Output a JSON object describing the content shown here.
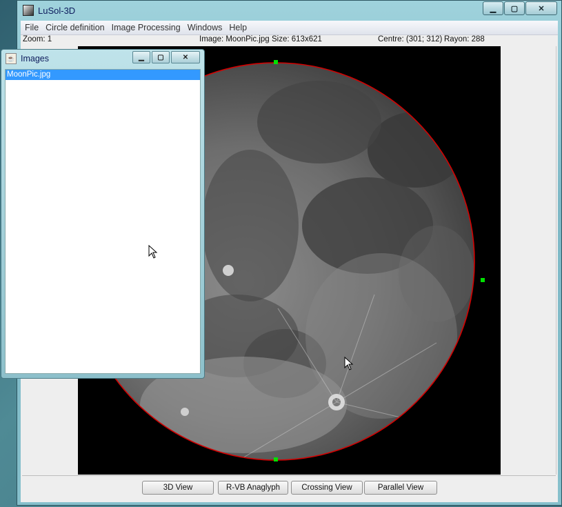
{
  "window": {
    "title": "LuSol-3D"
  },
  "menubar": {
    "items": [
      "File",
      "Circle definition",
      "Image Processing",
      "Windows",
      "Help"
    ]
  },
  "status": {
    "zoom": "Zoom: 1",
    "image": "Image: MoonPic.jpg",
    "size": "Size: 613x621",
    "centre": "Centre: (301; 312)",
    "rayon": "Rayon: 288"
  },
  "buttons": {
    "view3d": "3D View",
    "anaglyph": "R-VB Anaglyph",
    "crossing": "Crossing View",
    "parallel": "Parallel View"
  },
  "images_frame": {
    "title": "Images",
    "items": [
      "MoonPic.jpg"
    ]
  },
  "colors": {
    "circle": "#d40000",
    "handle": "#00e000",
    "selection": "#3399ff"
  },
  "icons": {
    "minimize": "minimize-icon",
    "maximize": "maximize-icon",
    "close": "close-icon"
  }
}
